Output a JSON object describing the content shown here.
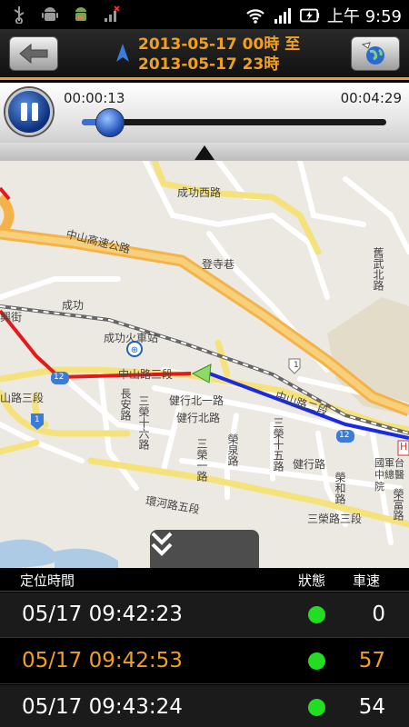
{
  "status_bar": {
    "time": "上午 9:59",
    "icons_left": [
      "usb-icon",
      "android-icon",
      "android-debug-icon",
      "signal-x-icon"
    ],
    "icons_right": [
      "wifi-icon",
      "cell-signal-icon",
      "battery-icon"
    ]
  },
  "header": {
    "title_line1": "2013-05-17 00時 至",
    "title_line2": "2013-05-17 23時",
    "accent_color": "#f0a020"
  },
  "playback": {
    "current_time": "00:00:13",
    "total_time": "00:04:29",
    "progress_fraction": 0.05
  },
  "map": {
    "labels": {
      "chenggong_w_rd": "成功西路",
      "zhongshan_hwy": "中山高速公路",
      "dengsi_alley": "登寺巷",
      "chenggong": "成功",
      "station": "成功火車站",
      "xing_st": "興街",
      "zhongshan_rd3": "中山路三段",
      "zhongshan_rd3_b": "中山路三段",
      "zhongshan_rd2": "中山路二段",
      "jiangong_rd": "健行北一路",
      "jiangong_n_rd": "健行北路",
      "sanrong_16": "三榮十六路",
      "sanrong_15": "三榮十五路",
      "jianxing_rd": "健行路",
      "rongherd": "榮和路",
      "sanrong_rd3": "三榮路三段",
      "huanhe_rd5": "環河路五段",
      "rongquan_rd": "榮泉路",
      "changan_rd": "長安路",
      "sanrong_rd1": "三榮一路",
      "rongfu_rd": "榮富路",
      "hospital": "國軍台中總醫院",
      "road_num_1": "1",
      "road_num_1b": "1",
      "road_num_12": "12",
      "road_num_12b": "12",
      "side_road": "舊武北路",
      "zhongshan_rd3_left": "山路三段",
      "h_marker": "H"
    }
  },
  "table": {
    "headers": {
      "time": "定位時間",
      "status": "狀態",
      "speed": "車速"
    },
    "rows": [
      {
        "time": "05/17 09:42:23",
        "speed": "0",
        "selected": false
      },
      {
        "time": "05/17 09:42:53",
        "speed": "57",
        "selected": true
      },
      {
        "time": "05/17 09:43:24",
        "speed": "54",
        "selected": false
      }
    ]
  }
}
